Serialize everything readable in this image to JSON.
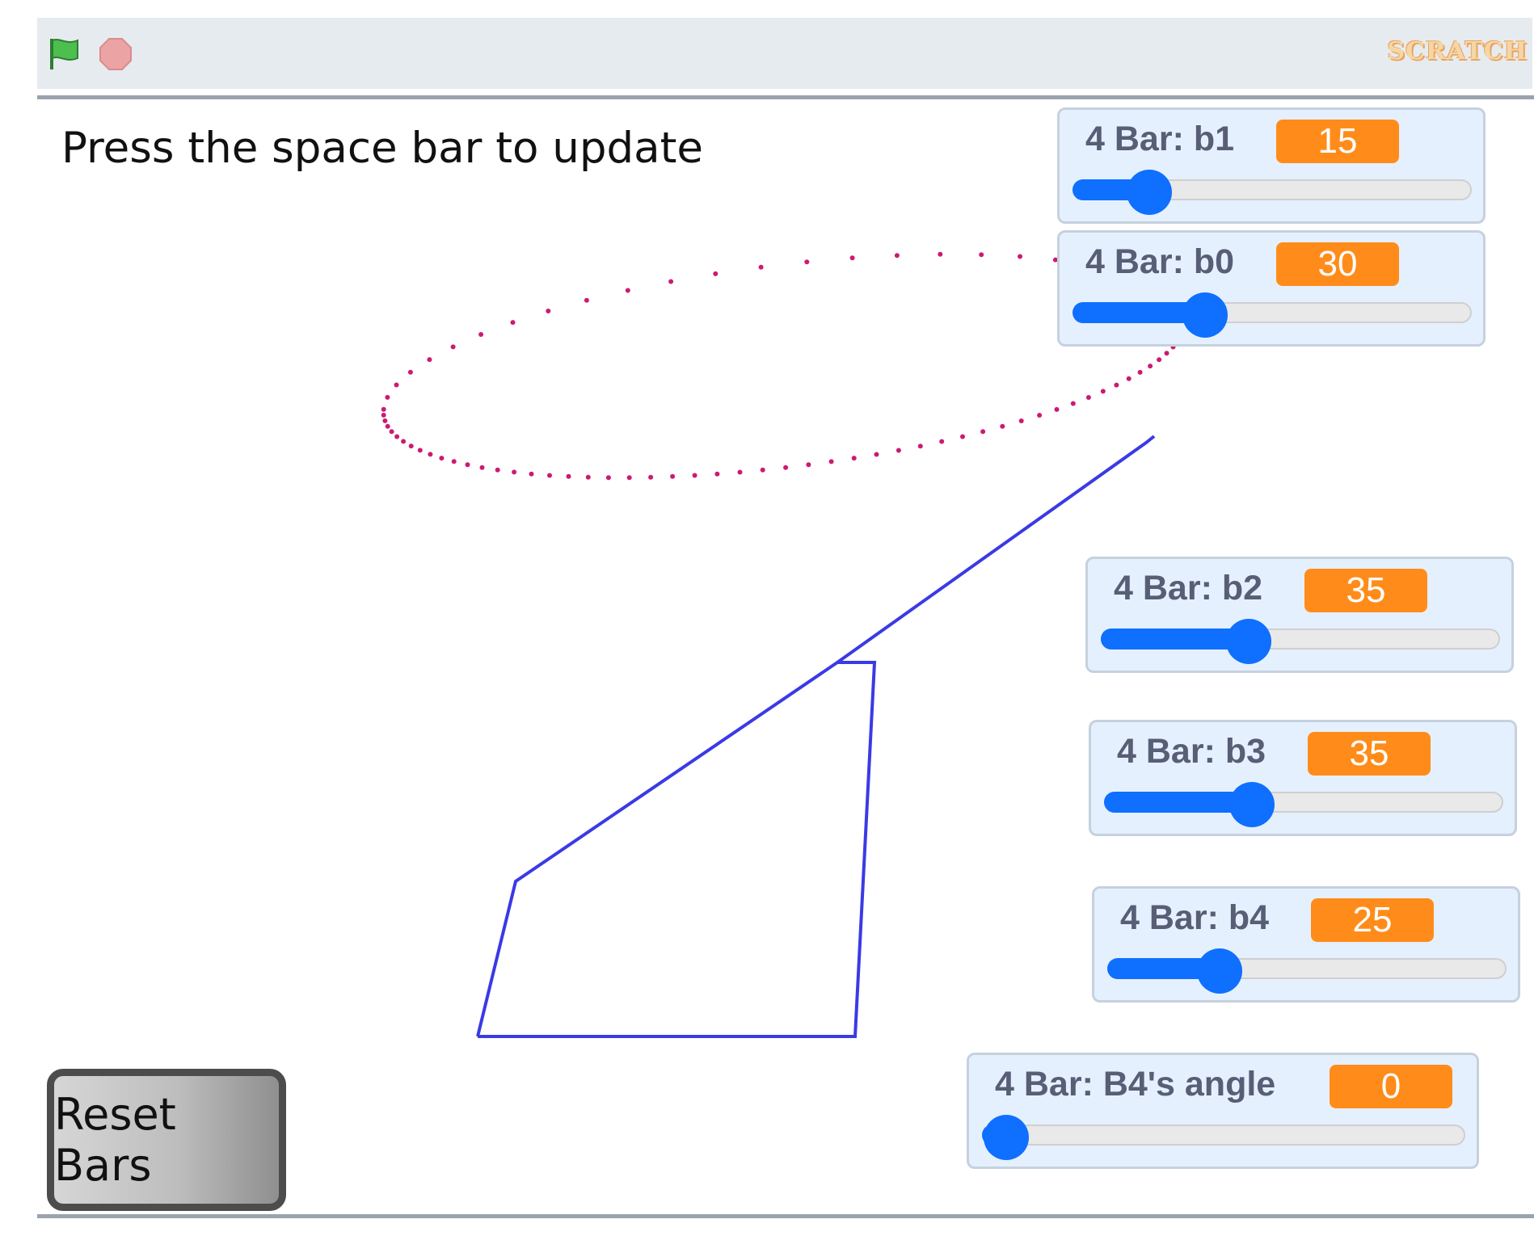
{
  "toolbar": {
    "green_flag_icon": "green-flag-icon",
    "stop_icon": "stop-sign-icon",
    "logo_text": "SCRATCH"
  },
  "stage": {
    "instruction": "Press the space bar to update",
    "reset_button": "Reset Bars"
  },
  "monitors": [
    {
      "label": "4 Bar: b1",
      "value": "15",
      "fraction": 0.19
    },
    {
      "label": "4 Bar: b0",
      "value": "30",
      "fraction": 0.33
    },
    {
      "label": "4 Bar: b2",
      "value": "35",
      "fraction": 0.37
    },
    {
      "label": "4 Bar: b3",
      "value": "35",
      "fraction": 0.37
    },
    {
      "label": "4 Bar: b4",
      "value": "25",
      "fraction": 0.28
    },
    {
      "label": "4 Bar: B4's angle",
      "value": "0",
      "fraction": 0.0
    }
  ],
  "colors": {
    "linkage": "#3a3ae6",
    "trace": "#cc1a73",
    "slider": "#0f6fff",
    "value_badge": "#ff8c1a",
    "monitor_bg": "#e5f0ff"
  }
}
